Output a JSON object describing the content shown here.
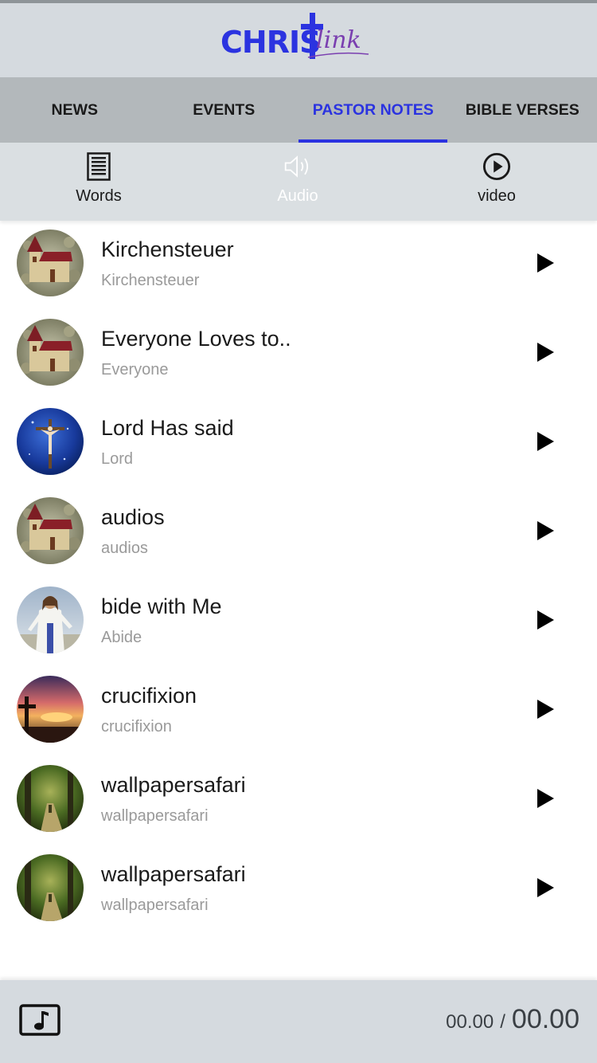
{
  "app": {
    "logo_main": "CHRIS",
    "logo_script": "link"
  },
  "tabs": [
    {
      "label": "NEWS",
      "active": false
    },
    {
      "label": "EVENTS",
      "active": false
    },
    {
      "label": "PASTOR NOTES",
      "active": true
    },
    {
      "label": "BIBLE VERSES",
      "active": false
    }
  ],
  "subtabs": [
    {
      "label": "Words",
      "icon": "document-icon"
    },
    {
      "label": "Audio",
      "icon": "speaker-icon",
      "selected": true
    },
    {
      "label": "video",
      "icon": "play-circle-icon"
    }
  ],
  "items": [
    {
      "title": "Kirchensteuer",
      "subtitle": "Kirchensteuer",
      "thumb": "church"
    },
    {
      "title": "Everyone Loves to..",
      "subtitle": "Everyone",
      "thumb": "church"
    },
    {
      "title": "Lord Has said",
      "subtitle": "Lord",
      "thumb": "crucifix"
    },
    {
      "title": "audios",
      "subtitle": "audios",
      "thumb": "church"
    },
    {
      "title": "bide with Me",
      "subtitle": "Abide",
      "thumb": "jesus"
    },
    {
      "title": "crucifixion",
      "subtitle": "crucifixion",
      "thumb": "sunset"
    },
    {
      "title": "wallpapersafari",
      "subtitle": "wallpapersafari",
      "thumb": "forest"
    },
    {
      "title": "wallpapersafari",
      "subtitle": "wallpapersafari",
      "thumb": "forest"
    }
  ],
  "player": {
    "current_time": "00.00",
    "separator": "/",
    "total_time": "00.00"
  },
  "colors": {
    "accent": "#2b33e0",
    "header_bg": "#d5dadf",
    "tabs_bg": "#b3b8bb"
  }
}
